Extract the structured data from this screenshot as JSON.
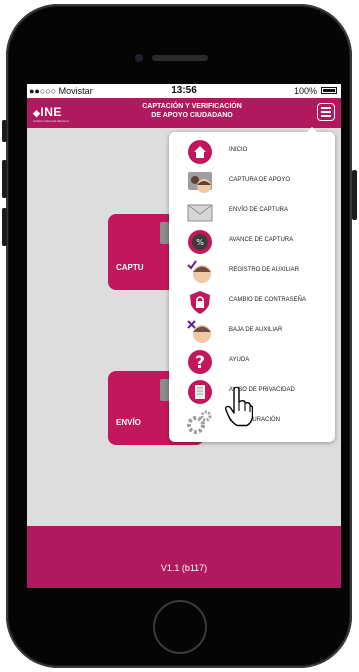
{
  "status_bar": {
    "carrier": "●●○○○ Movistar",
    "time": "13:56",
    "battery": "100%"
  },
  "header": {
    "logo": "INE",
    "logo_sub": "Instituto Nacional Electoral",
    "title_line1": "CAPTACIÓN Y VERIFICACIÓN",
    "title_line2": "DE APOYO CIUDADANO"
  },
  "tiles": {
    "capture_label": "CAPTU",
    "send_label": "ENVÍO"
  },
  "menu": {
    "items": [
      {
        "label": "INICIO",
        "icon": "home-icon"
      },
      {
        "label": "CAPTURA DE APOYO",
        "icon": "id-card-icon"
      },
      {
        "label": "ENVÍO DE CAPTURA",
        "icon": "envelope-icon"
      },
      {
        "label": "AVANCE DE CAPTURA",
        "icon": "percent-icon"
      },
      {
        "label": "REGISTRO DE AUXILIAR",
        "icon": "add-user-icon"
      },
      {
        "label": "CAMBIO DE CONTRASEÑA",
        "icon": "lock-shield-icon"
      },
      {
        "label": "BAJA DE AUXILIAR",
        "icon": "remove-user-icon"
      },
      {
        "label": "AYUDA",
        "icon": "help-icon"
      },
      {
        "label": "AVISO DE PRIVACIDAD",
        "icon": "document-icon"
      },
      {
        "label": "CONFIGURACIÓN",
        "icon": "gears-icon"
      }
    ]
  },
  "footer": {
    "version": "V1.1 (b117)"
  },
  "colors": {
    "brand": "#b0195d",
    "tile": "#c2185b",
    "background": "#dddddd"
  }
}
